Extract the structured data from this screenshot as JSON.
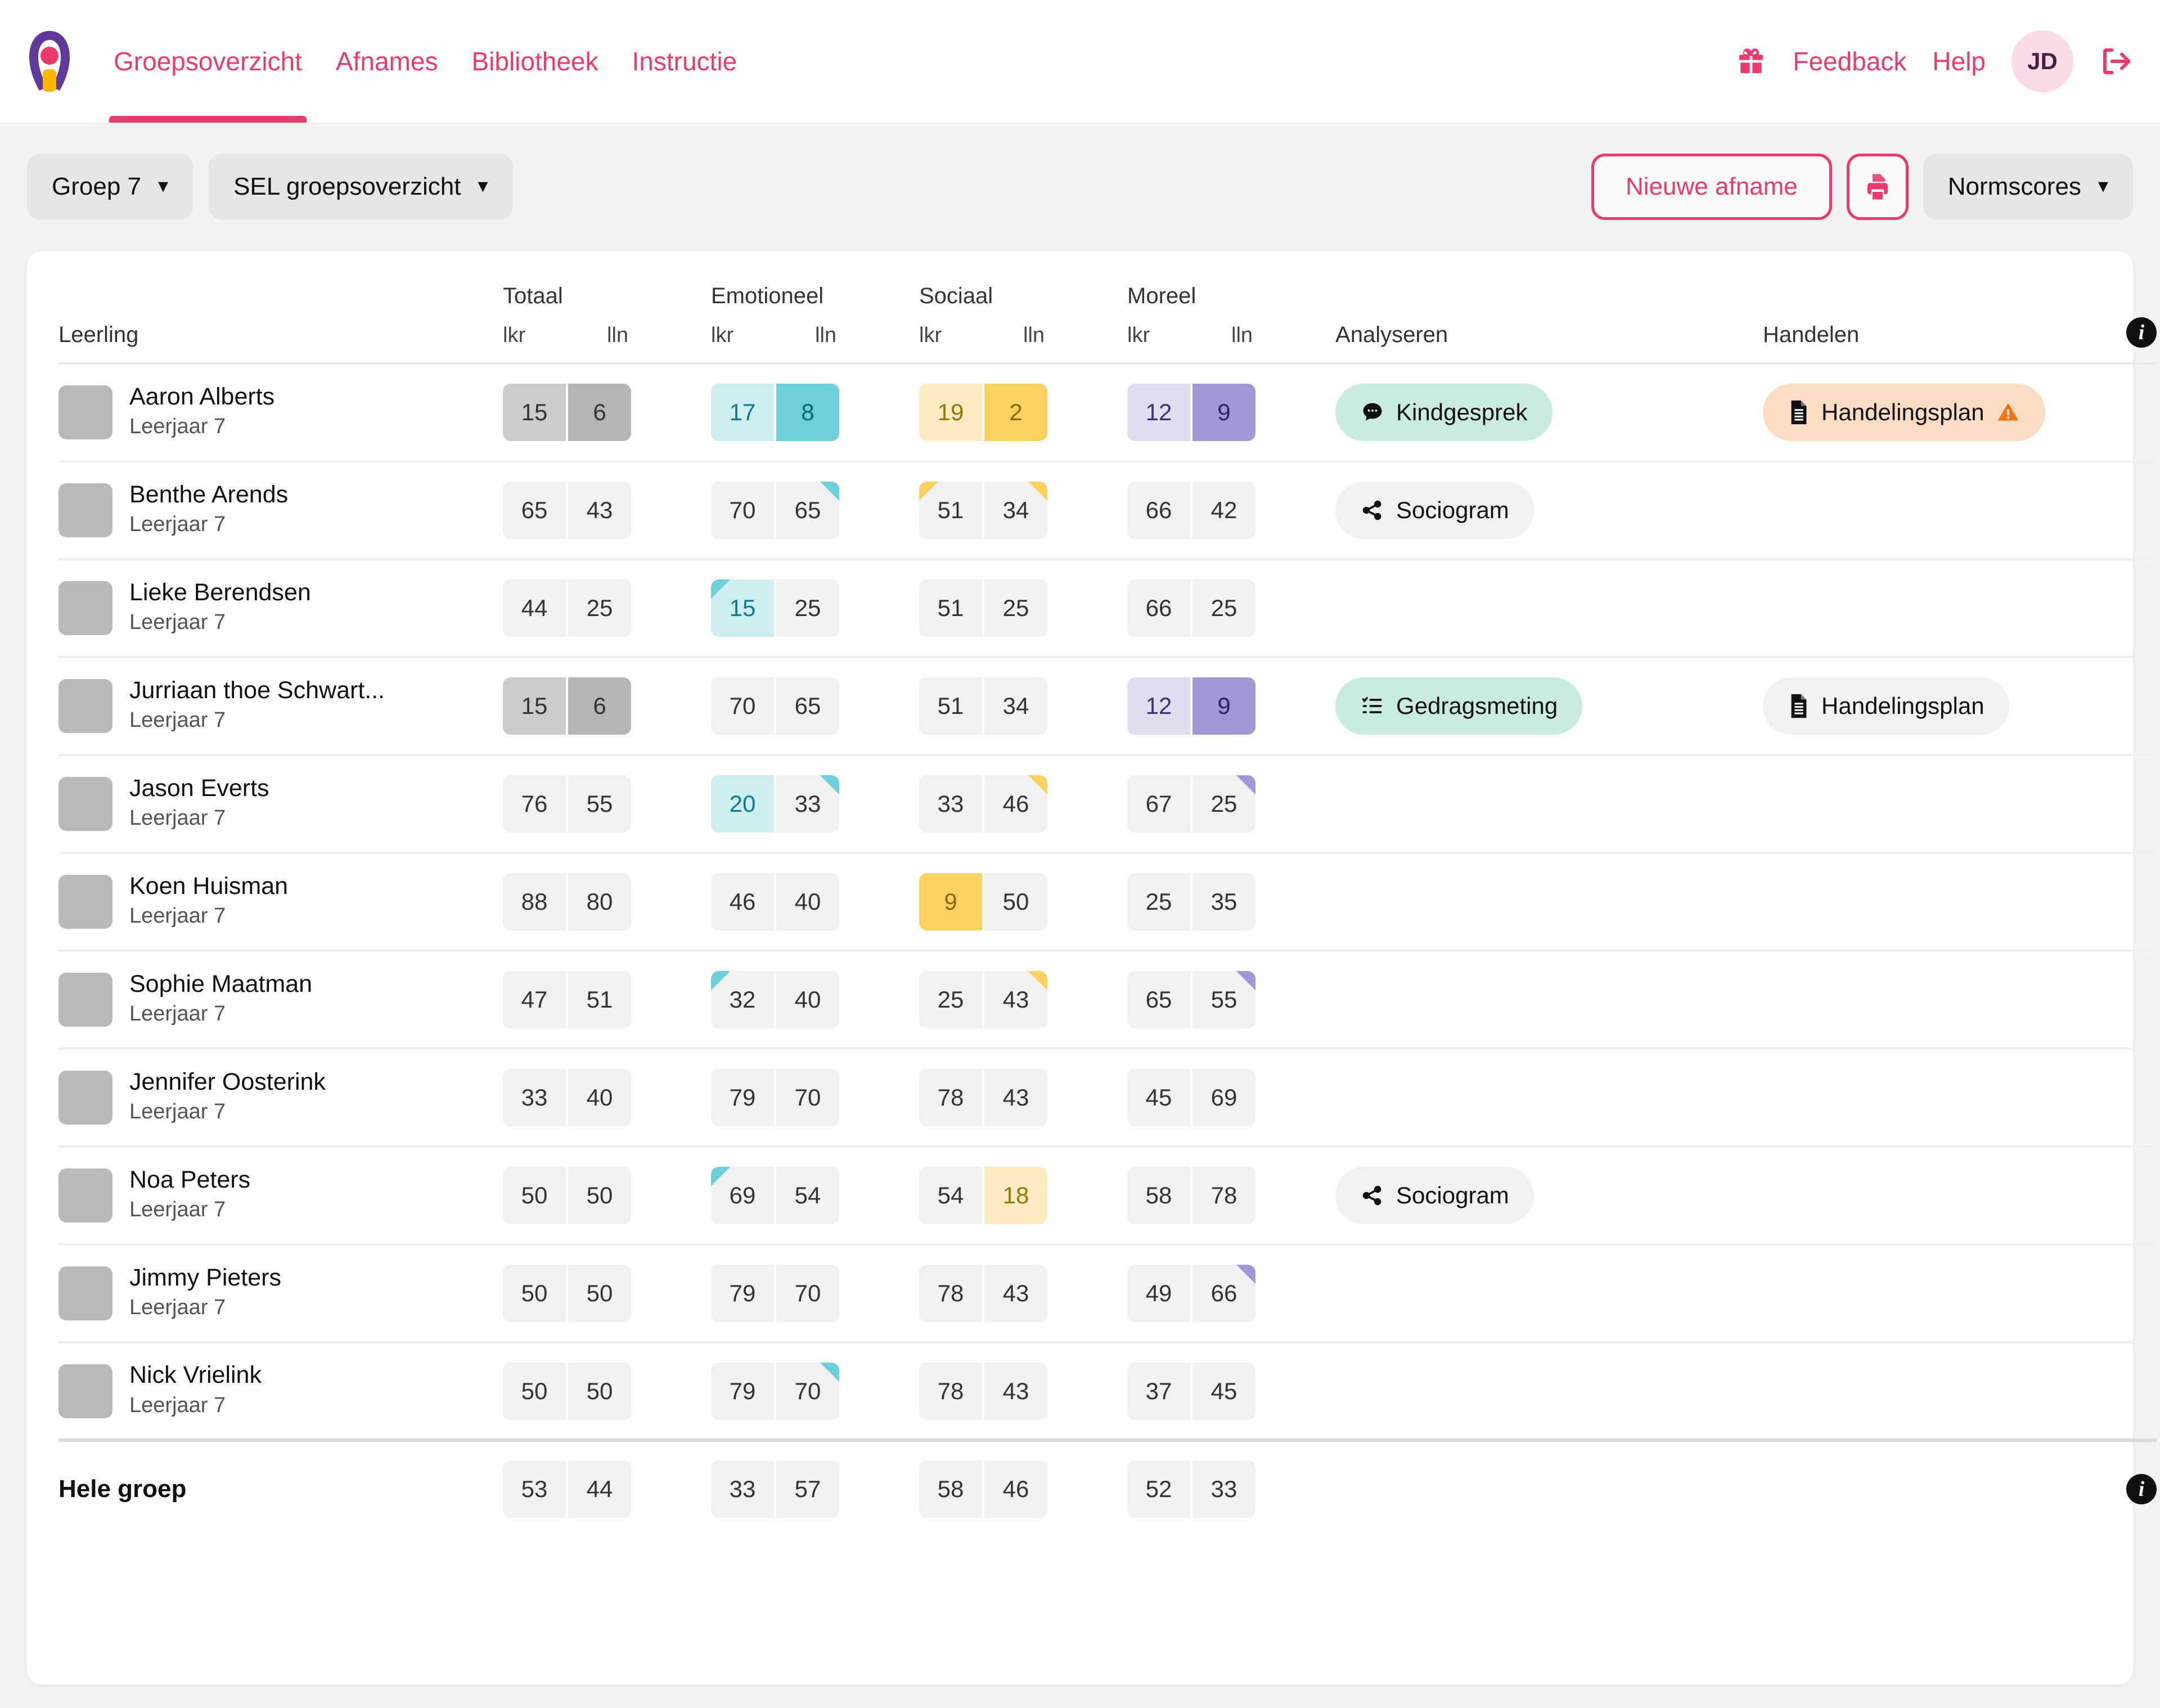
{
  "brand": {
    "accent": "#eb3b6e",
    "logo_name": "keyhole-logo"
  },
  "nav": {
    "links": [
      {
        "label": "Groepsoverzicht",
        "active": true
      },
      {
        "label": "Afnames",
        "active": false
      },
      {
        "label": "Bibliotheek",
        "active": false
      },
      {
        "label": "Instructie",
        "active": false
      }
    ],
    "right": {
      "gift_icon": "gift-icon",
      "feedback": "Feedback",
      "help": "Help",
      "avatar_initials": "JD",
      "logout_icon": "logout-icon"
    }
  },
  "toolbar": {
    "group_select": "Groep 7",
    "overview_select": "SEL groepsoverzicht",
    "new_assessment": "Nieuwe afname",
    "print_icon": "print-icon",
    "score_select": "Normscores"
  },
  "table": {
    "col_student": "Leerling",
    "groups": [
      {
        "title": "Totaal",
        "sub": [
          "lkr",
          "lln"
        ]
      },
      {
        "title": "Emotioneel",
        "sub": [
          "lkr",
          "lln"
        ]
      },
      {
        "title": "Sociaal",
        "sub": [
          "lkr",
          "lln"
        ]
      },
      {
        "title": "Moreel",
        "sub": [
          "lkr",
          "lln"
        ]
      }
    ],
    "col_analyse": "Analyseren",
    "col_handel": "Handelen",
    "info_icon": "info-icon",
    "year_label": "Leerjaar 7",
    "total_label": "Hele groep",
    "rows": [
      {
        "name": "Aaron Alberts",
        "year": "Leerjaar 7",
        "totaal": {
          "lkr": "15",
          "lln": "6",
          "lkr_tone": "grey-l",
          "lln_tone": "grey-d"
        },
        "emo": {
          "lkr": "17",
          "lln": "8",
          "lkr_tone": "teal-l",
          "lln_tone": "teal-d"
        },
        "soc": {
          "lkr": "19",
          "lln": "2",
          "lkr_tone": "yel-l",
          "lln_tone": "yel-d"
        },
        "mor": {
          "lkr": "12",
          "lln": "9",
          "lkr_tone": "pur-l",
          "lln_tone": "pur-d"
        },
        "analyse": {
          "label": "Kindgesprek",
          "style": "mint",
          "icon": "chat-bubble-icon"
        },
        "handel": {
          "label": "Handelingsplan",
          "style": "peach",
          "icon": "document-icon",
          "warn": true
        }
      },
      {
        "name": "Benthe Arends",
        "year": "Leerjaar 7",
        "totaal": {
          "lkr": "65",
          "lln": "43"
        },
        "emo": {
          "lkr": "70",
          "lln": "65",
          "lln_corner": "teal-tr"
        },
        "soc": {
          "lkr": "51",
          "lln": "34",
          "lkr_corner": "yel-tl",
          "lln_corner": "yel-tr"
        },
        "mor": {
          "lkr": "66",
          "lln": "42"
        },
        "analyse": {
          "label": "Sociogram",
          "style": "plain",
          "icon": "share-icon"
        },
        "handel": null
      },
      {
        "name": "Lieke Berendsen",
        "year": "Leerjaar 7",
        "totaal": {
          "lkr": "44",
          "lln": "25"
        },
        "emo": {
          "lkr": "15",
          "lln": "25",
          "lkr_tone": "teal-l",
          "lkr_corner": "teal-tl"
        },
        "soc": {
          "lkr": "51",
          "lln": "25"
        },
        "mor": {
          "lkr": "66",
          "lln": "25"
        },
        "analyse": null,
        "handel": null
      },
      {
        "name": "Jurriaan thoe Schwart...",
        "year": "Leerjaar 7",
        "totaal": {
          "lkr": "15",
          "lln": "6",
          "lkr_tone": "grey-l",
          "lln_tone": "grey-d"
        },
        "emo": {
          "lkr": "70",
          "lln": "65"
        },
        "soc": {
          "lkr": "51",
          "lln": "34"
        },
        "mor": {
          "lkr": "12",
          "lln": "9",
          "lkr_tone": "pur-l",
          "lln_tone": "pur-d",
          "lln_corner": "pur-tr"
        },
        "analyse": {
          "label": "Gedragsmeting",
          "style": "mint",
          "icon": "checklist-icon"
        },
        "handel": {
          "label": "Handelingsplan",
          "style": "plain",
          "icon": "document-icon",
          "warn": false
        }
      },
      {
        "name": "Jason Everts",
        "year": "Leerjaar 7",
        "totaal": {
          "lkr": "76",
          "lln": "55"
        },
        "emo": {
          "lkr": "20",
          "lln": "33",
          "lkr_tone": "teal-l",
          "lln_corner": "teal-tr"
        },
        "soc": {
          "lkr": "33",
          "lln": "46",
          "lln_corner": "yel-tr"
        },
        "mor": {
          "lkr": "67",
          "lln": "25",
          "lln_corner": "pur-tr"
        },
        "analyse": null,
        "handel": null
      },
      {
        "name": "Koen Huisman",
        "year": "Leerjaar 7",
        "totaal": {
          "lkr": "88",
          "lln": "80"
        },
        "emo": {
          "lkr": "46",
          "lln": "40"
        },
        "soc": {
          "lkr": "9",
          "lln": "50",
          "lkr_tone": "yel-d"
        },
        "mor": {
          "lkr": "25",
          "lln": "35"
        },
        "analyse": null,
        "handel": null
      },
      {
        "name": "Sophie Maatman",
        "year": "Leerjaar 7",
        "totaal": {
          "lkr": "47",
          "lln": "51"
        },
        "emo": {
          "lkr": "32",
          "lln": "40",
          "lkr_corner": "teal-tl"
        },
        "soc": {
          "lkr": "25",
          "lln": "43",
          "lln_corner": "yel-tr"
        },
        "mor": {
          "lkr": "65",
          "lln": "55",
          "lln_corner": "pur-tr"
        },
        "analyse": null,
        "handel": null
      },
      {
        "name": "Jennifer Oosterink",
        "year": "Leerjaar 7",
        "totaal": {
          "lkr": "33",
          "lln": "40"
        },
        "emo": {
          "lkr": "79",
          "lln": "70"
        },
        "soc": {
          "lkr": "78",
          "lln": "43"
        },
        "mor": {
          "lkr": "45",
          "lln": "69"
        },
        "analyse": null,
        "handel": null
      },
      {
        "name": "Noa Peters",
        "year": "Leerjaar 7",
        "totaal": {
          "lkr": "50",
          "lln": "50"
        },
        "emo": {
          "lkr": "69",
          "lln": "54",
          "lkr_corner": "teal-tl"
        },
        "soc": {
          "lkr": "54",
          "lln": "18",
          "lln_tone": "yel-l"
        },
        "mor": {
          "lkr": "58",
          "lln": "78"
        },
        "analyse": {
          "label": "Sociogram",
          "style": "plain",
          "icon": "share-icon"
        },
        "handel": null
      },
      {
        "name": "Jimmy Pieters",
        "year": "Leerjaar 7",
        "totaal": {
          "lkr": "50",
          "lln": "50"
        },
        "emo": {
          "lkr": "79",
          "lln": "70"
        },
        "soc": {
          "lkr": "78",
          "lln": "43"
        },
        "mor": {
          "lkr": "49",
          "lln": "66",
          "lln_corner": "pur-tr"
        },
        "analyse": null,
        "handel": null
      },
      {
        "name": "Nick Vrielink",
        "year": "Leerjaar 7",
        "totaal": {
          "lkr": "50",
          "lln": "50"
        },
        "emo": {
          "lkr": "79",
          "lln": "70",
          "lln_corner": "teal-tr"
        },
        "soc": {
          "lkr": "78",
          "lln": "43"
        },
        "mor": {
          "lkr": "37",
          "lln": "45"
        },
        "analyse": null,
        "handel": null
      }
    ],
    "totals": {
      "label": "Hele groep",
      "totaal": {
        "lkr": "53",
        "lln": "44"
      },
      "emo": {
        "lkr": "33",
        "lln": "57"
      },
      "soc": {
        "lkr": "58",
        "lln": "46"
      },
      "mor": {
        "lkr": "52",
        "lln": "33"
      }
    }
  }
}
